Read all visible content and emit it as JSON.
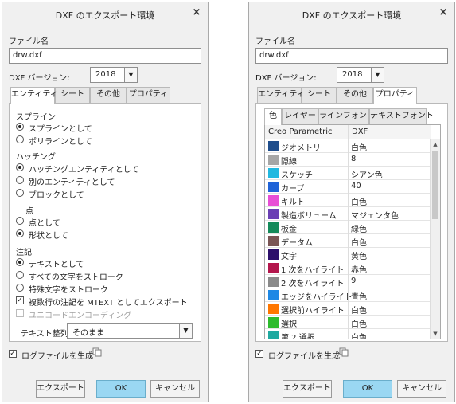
{
  "left": {
    "title": "DXF のエクスポート環境",
    "close": "×",
    "filename_label": "ファイル名",
    "filename_value": "drw.dxf",
    "version_label": "DXF バージョン:",
    "version_value": "2018",
    "tabs": [
      "エンティティ",
      "シート",
      "その他",
      "プロパティ"
    ],
    "spline": {
      "heading": "スプライン",
      "options": [
        "スプラインとして",
        "ポリラインとして"
      ]
    },
    "hatching": {
      "heading": "ハッチング",
      "options": [
        "ハッチングエンティティとして",
        "別のエンティティとして",
        "ブロックとして"
      ]
    },
    "point": {
      "heading": "点",
      "options": [
        "点として",
        "形状として"
      ]
    },
    "note": {
      "heading": "注記",
      "options": [
        "テキストとして",
        "すべての文字をストローク",
        "特殊文字をストローク"
      ],
      "check_mtext": "複数行の注記を MTEXT としてエクスポート",
      "check_unicode": "ユニコードエンコーディング"
    },
    "text_align_label": "テキスト整列",
    "text_align_value": "そのまま",
    "logfile_label": "ログファイルを生成",
    "buttons": {
      "export": "エクスポート",
      "ok": "OK",
      "cancel": "キャンセル"
    }
  },
  "right": {
    "title": "DXF のエクスポート環境",
    "close": "×",
    "filename_label": "ファイル名",
    "filename_value": "drw.dxf",
    "version_label": "DXF バージョン:",
    "version_value": "2018",
    "tabs": [
      "エンティティ",
      "シート",
      "その他",
      "プロパティ"
    ],
    "subtabs": [
      "色",
      "レイヤー",
      "ラインフォント",
      "テキストフォント"
    ],
    "columns": [
      "Creo Parametric",
      "DXF"
    ],
    "rows": [
      {
        "name": "ジオメトリ",
        "value": "白色",
        "color": "#1f4e8c"
      },
      {
        "name": "隠線",
        "value": "8",
        "color": "#a6a6a6"
      },
      {
        "name": "スケッチ",
        "value": "シアン色",
        "color": "#21b8e0"
      },
      {
        "name": "カーブ",
        "value": "40",
        "color": "#1f63d8"
      },
      {
        "name": "キルト",
        "value": "白色",
        "color": "#e84ed6"
      },
      {
        "name": "製造ボリューム",
        "value": "マジェンタ色",
        "color": "#6a3fb4"
      },
      {
        "name": "板金",
        "value": "緑色",
        "color": "#148a5a"
      },
      {
        "name": "データム",
        "value": "白色",
        "color": "#7a5555"
      },
      {
        "name": "文字",
        "value": "黄色",
        "color": "#2c0f6b"
      },
      {
        "name": "1 次をハイライト",
        "value": "赤色",
        "color": "#b3164c"
      },
      {
        "name": "2 次をハイライト",
        "value": "9",
        "color": "#8a8a8a"
      },
      {
        "name": "エッジをハイライト",
        "value": "青色",
        "color": "#1e88e5"
      },
      {
        "name": "選択前ハイライト",
        "value": "白色",
        "color": "#ff7700"
      },
      {
        "name": "選択",
        "value": "白色",
        "color": "#2dbb2d"
      },
      {
        "name": "第 2 選択",
        "value": "白色",
        "color": "#1fa9a0"
      }
    ],
    "logfile_label": "ログファイルを生成",
    "buttons": {
      "export": "エクスポート",
      "ok": "OK",
      "cancel": "キャンセル"
    }
  }
}
